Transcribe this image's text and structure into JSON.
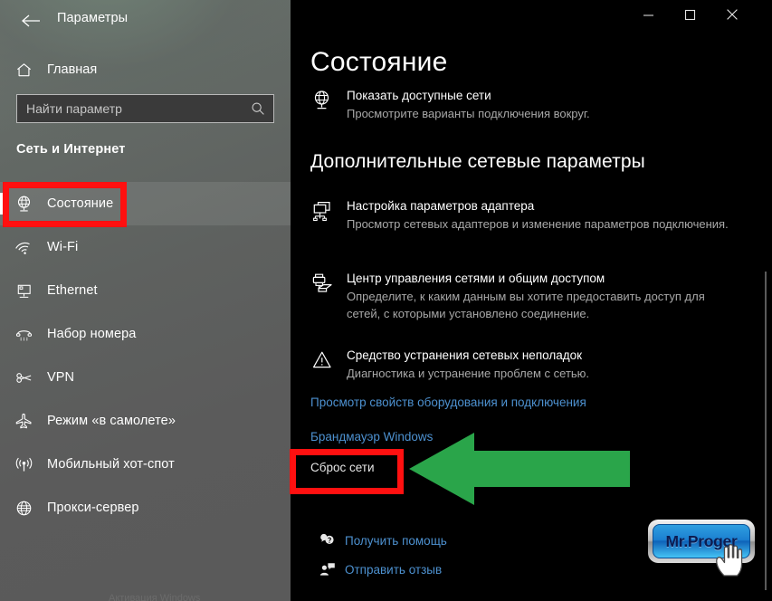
{
  "window": {
    "sidebar_title": "Параметры",
    "back_icon": "back-arrow-icon",
    "controls": {
      "minimize": "minimize-icon",
      "maximize": "maximize-icon",
      "close": "close-icon"
    }
  },
  "sidebar": {
    "home_label": "Главная",
    "home_icon": "home-icon",
    "search": {
      "placeholder": "Найти параметр",
      "value": "",
      "icon": "search-icon"
    },
    "section_label": "Сеть и Интернет",
    "items": [
      {
        "label": "Состояние",
        "icon": "globe-status-icon",
        "selected": true
      },
      {
        "label": "Wi-Fi",
        "icon": "wifi-icon",
        "selected": false
      },
      {
        "label": "Ethernet",
        "icon": "ethernet-icon",
        "selected": false
      },
      {
        "label": "Набор номера",
        "icon": "dialup-phone-icon",
        "selected": false
      },
      {
        "label": "VPN",
        "icon": "vpn-key-icon",
        "selected": false
      },
      {
        "label": "Режим «в самолете»",
        "icon": "airplane-icon",
        "selected": false
      },
      {
        "label": "Мобильный хот-спот",
        "icon": "hotspot-icon",
        "selected": false
      },
      {
        "label": "Прокси-сервер",
        "icon": "proxy-globe-icon",
        "selected": false
      }
    ],
    "bottom_faint_text": "Активация Windows"
  },
  "main": {
    "page_title": "Состояние",
    "show_networks": {
      "title": "Показать доступные сети",
      "desc": "Просмотрите варианты подключения вокруг.",
      "icon": "globe-monitor-icon"
    },
    "section_title": "Дополнительные сетевые параметры",
    "entries": [
      {
        "title": "Настройка параметров адаптера",
        "desc": "Просмотр сетевых адаптеров и изменение параметров подключения.",
        "icon": "network-adapters-icon"
      },
      {
        "title": "Центр управления сетями и общим доступом",
        "desc": "Определите, к каким данным вы хотите предоставить доступ для сетей, с которыми установлено соединение.",
        "icon": "sharing-center-icon"
      },
      {
        "title": "Средство устранения сетевых неполадок",
        "desc": "Диагностика и устранение проблем с сетью.",
        "icon": "troubleshoot-warning-icon"
      }
    ],
    "links": [
      {
        "label": "Просмотр свойств оборудования и подключения"
      },
      {
        "label": "Брандмауэр Windows"
      }
    ],
    "reset_label": "Сброс сети",
    "footer_links": [
      {
        "label": "Получить помощь",
        "icon": "help-bubble-icon"
      },
      {
        "label": "Отправить отзыв",
        "icon": "feedback-person-icon"
      }
    ]
  },
  "annotations": {
    "highlight_color": "#ff1010",
    "arrow_color": "#2aa54a",
    "arrow_direction": "left",
    "highlighted_sidebar_item": "Состояние",
    "highlighted_main_item": "Сброс сети"
  },
  "watermark": {
    "text": "Mr.Proger",
    "cursor_icon": "hand-cursor-icon"
  }
}
